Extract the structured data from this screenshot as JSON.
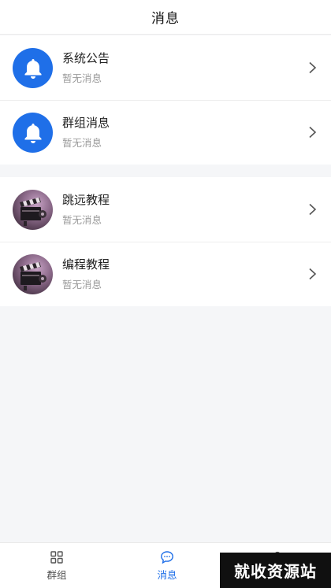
{
  "header": {
    "title": "消息"
  },
  "groups": [
    {
      "items": [
        {
          "title": "系统公告",
          "subtitle": "暂无消息",
          "avatar_icon": "bell-icon"
        },
        {
          "title": "群组消息",
          "subtitle": "暂无消息",
          "avatar_icon": "bell-icon"
        }
      ]
    },
    {
      "items": [
        {
          "title": "跳远教程",
          "subtitle": "暂无消息",
          "avatar_icon": "film-clapper-icon"
        },
        {
          "title": "编程教程",
          "subtitle": "暂无消息",
          "avatar_icon": "film-clapper-icon"
        }
      ]
    }
  ],
  "tabbar": {
    "tabs": [
      {
        "label": "群组",
        "icon": "grid-icon",
        "active": false
      },
      {
        "label": "消息",
        "icon": "chat-bubble-icon",
        "active": true
      },
      {
        "label": "",
        "icon": "user-icon",
        "active": false
      }
    ]
  },
  "watermark": {
    "text": "就收资源站"
  },
  "colors": {
    "accent": "#1f6fe8",
    "background": "#f5f6f8"
  }
}
